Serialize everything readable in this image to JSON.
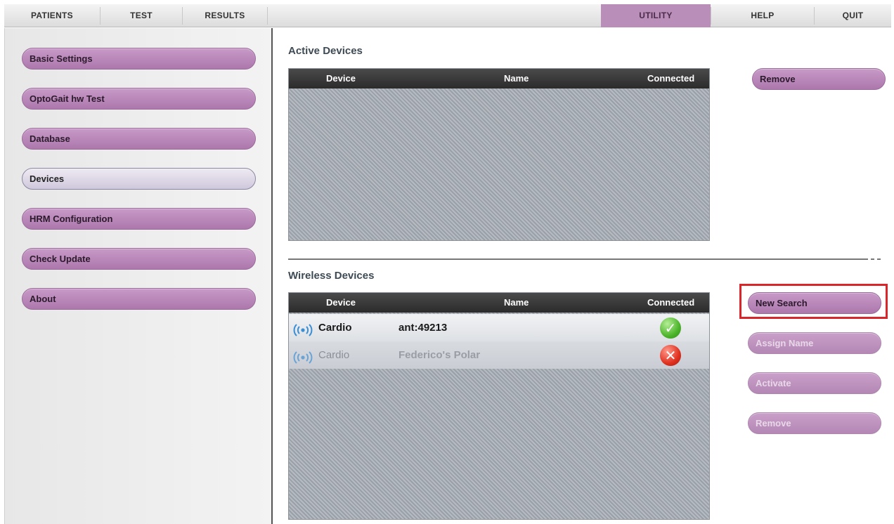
{
  "menu": {
    "patients": "PATIENTS",
    "test": "TEST",
    "results": "RESULTS",
    "utility": "UTILITY",
    "help": "HELP",
    "quit": "QUIT",
    "active_item": "UTILITY"
  },
  "sidebar": {
    "items": [
      {
        "label": "Basic Settings"
      },
      {
        "label": "OptoGait hw Test"
      },
      {
        "label": "Database"
      },
      {
        "label": "Devices",
        "selected": true
      },
      {
        "label": "HRM Configuration"
      },
      {
        "label": "Check Update"
      },
      {
        "label": "About"
      }
    ]
  },
  "active_devices": {
    "title": "Active Devices",
    "columns": {
      "device": "Device",
      "name": "Name",
      "connected": "Connected"
    },
    "rows": [],
    "remove_label": "Remove"
  },
  "wireless_devices": {
    "title": "Wireless Devices",
    "columns": {
      "device": "Device",
      "name": "Name",
      "connected": "Connected"
    },
    "rows": [
      {
        "device": "Cardio",
        "name": "ant:49213",
        "connected": true,
        "icon": "wireless-icon",
        "status_icon": "check-icon"
      },
      {
        "device": "Cardio",
        "name": "Federico's Polar",
        "connected": false,
        "icon": "wireless-icon",
        "status_icon": "x-icon"
      }
    ],
    "buttons": {
      "new_search": "New Search",
      "assign_name": "Assign Name",
      "activate": "Activate",
      "remove": "Remove"
    }
  },
  "colors": {
    "accent": "#b98fb9",
    "highlight": "#d9262b",
    "table_header": "#2b2b2b"
  }
}
